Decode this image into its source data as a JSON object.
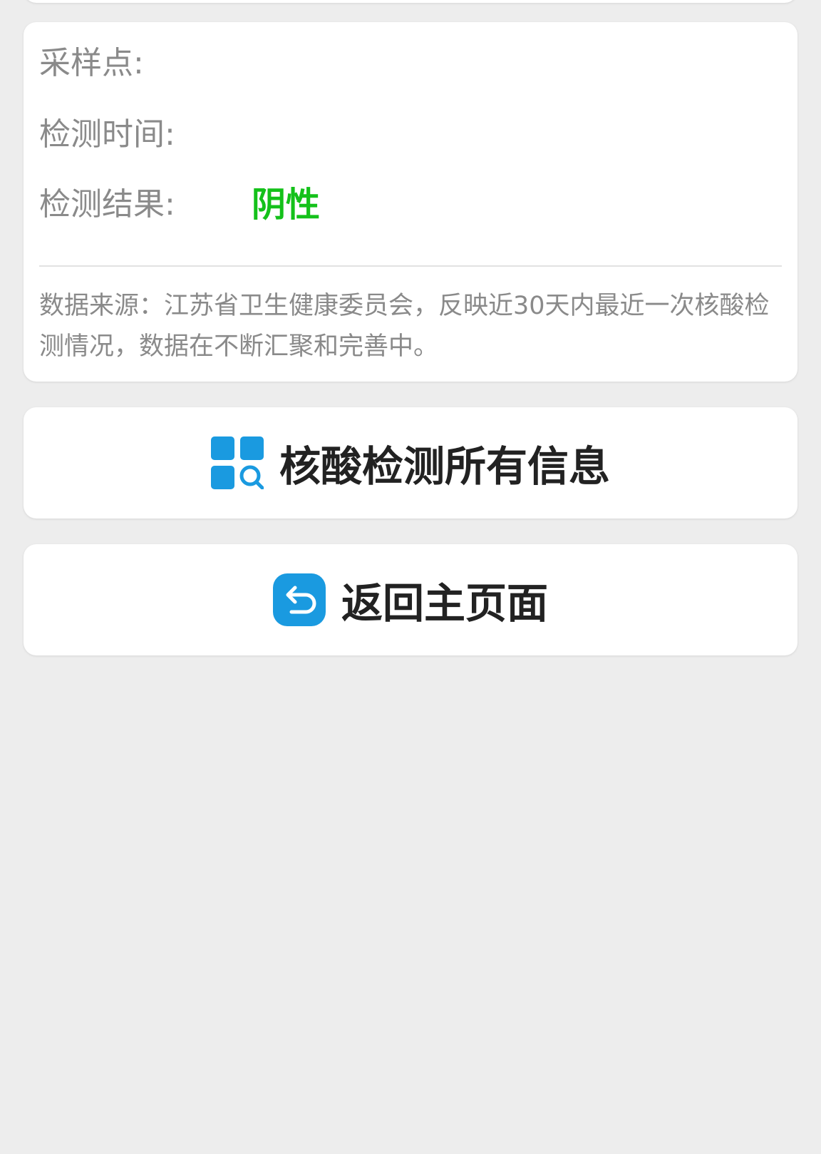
{
  "info_card": {
    "sample_site_label": "采样点:",
    "test_time_label": "检测时间:",
    "test_result_label": "检测结果:",
    "test_result_value": "阴性",
    "result_color": "#14c11a",
    "source_note": "数据来源：江苏省卫生健康委员会，反映近30天内最近一次核酸检测情况，数据在不断汇聚和完善中。"
  },
  "actions": {
    "all_info": {
      "label": "核酸检测所有信息",
      "icon": "grid-search-icon"
    },
    "home": {
      "label": "返回主页面",
      "icon": "return-arrow-icon"
    }
  },
  "colors": {
    "icon_blue": "#1a9ae0",
    "background": "#ededed"
  }
}
